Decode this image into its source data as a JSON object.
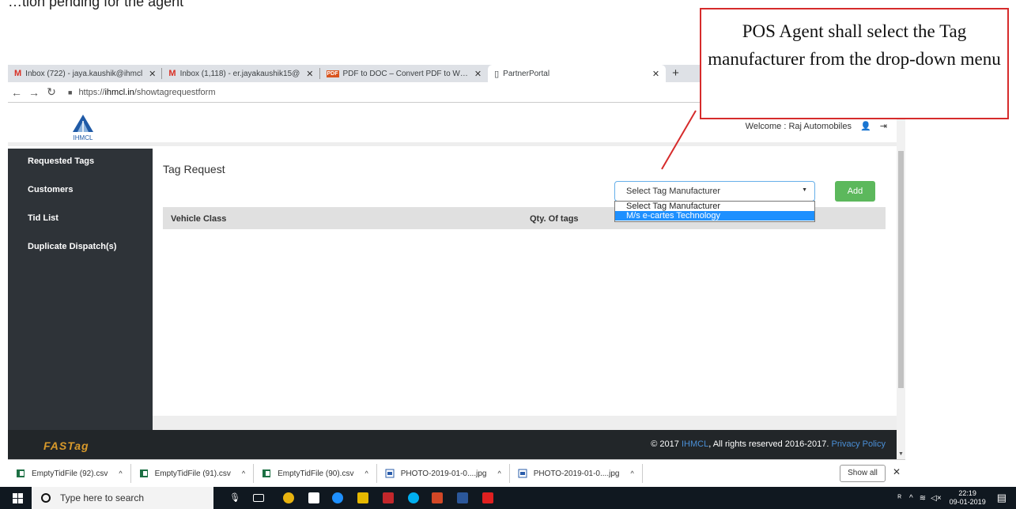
{
  "top_text": "…tion pending for the agent",
  "browser": {
    "tabs": [
      {
        "label": "Inbox (722) - jaya.kaushik@ihmcl",
        "icon": "gmail-icon"
      },
      {
        "label": "Inbox (1,118) - er.jayakaushik15@",
        "icon": "gmail-icon"
      },
      {
        "label": "PDF to DOC – Convert PDF to W…",
        "icon": "pdf-icon"
      },
      {
        "label": "PartnerPortal",
        "icon": "page-icon"
      }
    ],
    "url_prefix": "https://",
    "url_host": "ihmcl.in",
    "url_path": "/showtagrequestform"
  },
  "header": {
    "logo_text": "IHMCL",
    "welcome": "Welcome : Raj Automobiles"
  },
  "sidebar": {
    "items": [
      "Requested Tags",
      "Customers",
      "Tid List",
      "Duplicate Dispatch(s)"
    ]
  },
  "main": {
    "title": "Tag Request",
    "select_value": "Select Tag Manufacturer",
    "select_options": [
      "Select Tag Manufacturer",
      "M/s e-cartes Technology"
    ],
    "add_label": "Add",
    "columns": [
      "Vehicle Class",
      "Qty. Of tags"
    ]
  },
  "footer": {
    "brand": "FASTag",
    "copy_prefix": "© 2017",
    "copy_link": "IHMCL",
    "copy_mid": ", All rights reserved 2016-2017.",
    "privacy": "Privacy Policy"
  },
  "downloads": {
    "items": [
      "EmptyTidFile (92).csv",
      "EmptyTidFile (91).csv",
      "EmptyTidFile (90).csv",
      "PHOTO-2019-01-0....jpg",
      "PHOTO-2019-01-0....jpg"
    ],
    "show_all": "Show all"
  },
  "taskbar": {
    "search_placeholder": "Type here to search",
    "time": "22:19",
    "date": "09-01-2019"
  },
  "callout": {
    "text": "POS Agent shall select the Tag manufacturer from the drop-down menu"
  },
  "colors": {
    "sidebar": "#2e3338",
    "add_button": "#5cb85c",
    "option_highlight": "#1e90ff",
    "callout_border": "#d62b2b",
    "footer_link": "#4a8fd6"
  }
}
